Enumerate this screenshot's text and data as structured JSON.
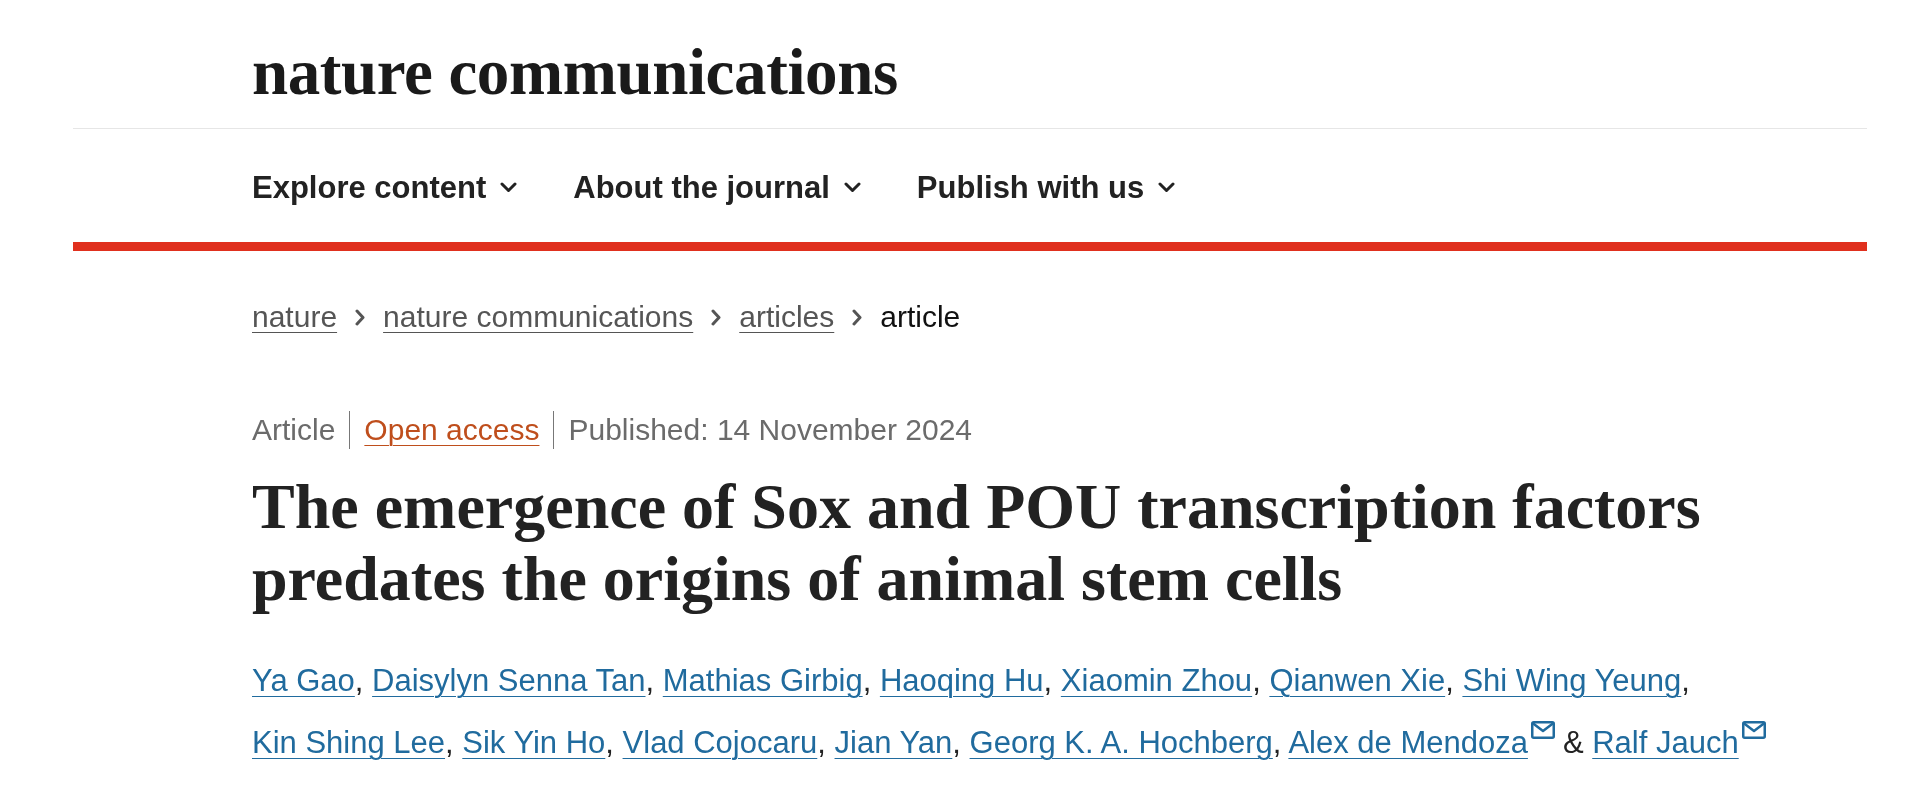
{
  "header": {
    "logo": "nature communications"
  },
  "nav": [
    {
      "label": "Explore content"
    },
    {
      "label": "About the journal"
    },
    {
      "label": "Publish with us"
    }
  ],
  "breadcrumbs": [
    {
      "label": "nature",
      "link": true
    },
    {
      "label": "nature communications",
      "link": true
    },
    {
      "label": "articles",
      "link": true
    },
    {
      "label": "article",
      "link": false
    }
  ],
  "article_meta": {
    "type": "Article",
    "access": "Open access",
    "published": "Published: 14 November 2024"
  },
  "title": "The emergence of Sox and POU transcription factors predates the origins of animal stem cells",
  "authors": [
    {
      "name": "Ya Gao",
      "email": false,
      "separator": ","
    },
    {
      "name": "Daisylyn Senna Tan",
      "email": false,
      "separator": ","
    },
    {
      "name": "Mathias Girbig",
      "email": false,
      "separator": ","
    },
    {
      "name": "Haoqing Hu",
      "email": false,
      "separator": ","
    },
    {
      "name": "Xiaomin Zhou",
      "email": false,
      "separator": ","
    },
    {
      "name": "Qianwen Xie",
      "email": false,
      "separator": ","
    },
    {
      "name": "Shi Wing Yeung",
      "email": false,
      "separator": ","
    },
    {
      "name": "Kin Shing Lee",
      "email": false,
      "separator": ","
    },
    {
      "name": "Sik Yin Ho",
      "email": false,
      "separator": ","
    },
    {
      "name": "Vlad Cojocaru",
      "email": false,
      "separator": ","
    },
    {
      "name": "Jian Yan",
      "email": false,
      "separator": ","
    },
    {
      "name": "Georg K. A. Hochberg",
      "email": false,
      "separator": ","
    },
    {
      "name": "Alex de Mendoza",
      "email": true,
      "separator": "&"
    },
    {
      "name": "Ralf Jauch",
      "email": true
    }
  ]
}
